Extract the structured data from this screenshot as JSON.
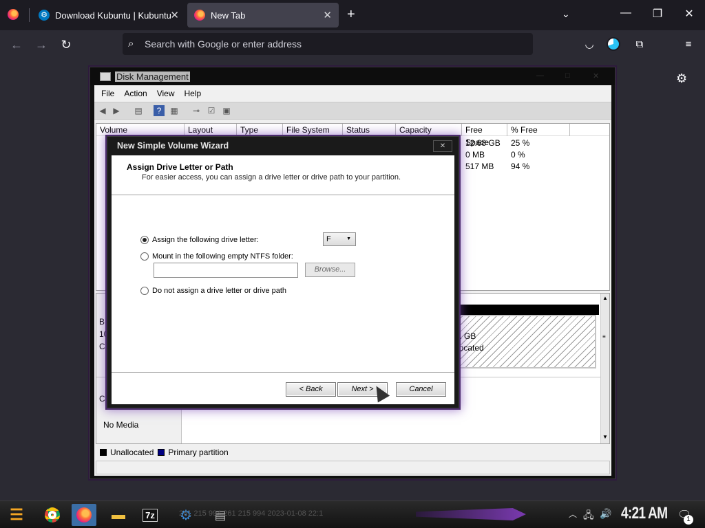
{
  "browser": {
    "tabs": [
      {
        "title": "Download Kubuntu | Kubuntu",
        "close": "✕"
      },
      {
        "title": "New Tab",
        "close": "✕"
      }
    ],
    "new_tab": "+",
    "tab_list": "⌄",
    "window_controls": {
      "minimize": "—",
      "maximize": "❐",
      "close": "✕"
    },
    "address_placeholder": "Search with Google or enter address"
  },
  "disk_mgmt": {
    "title": "Disk Management",
    "menu": [
      "File",
      "Action",
      "View",
      "Help"
    ],
    "columns": [
      "Volume",
      "Layout",
      "Type",
      "File System",
      "Status",
      "Capacity",
      "Free Space",
      "% Free"
    ],
    "rows": [
      {
        "free_space": "12.68 GB",
        "pct_free": "25 %"
      },
      {
        "free_space": "0 MB",
        "pct_free": "0 %"
      },
      {
        "free_space": "517 MB",
        "pct_free": "94 %"
      }
    ],
    "graph_left_fragments": [
      "B",
      "10",
      "C",
      "C"
    ],
    "unalloc_size": "1 GB",
    "unalloc_label": "located",
    "no_media": "No Media",
    "legend": {
      "unallocated": "Unallocated",
      "primary": "Primary partition"
    },
    "colors": {
      "unallocated": "#000000",
      "primary": "#000080"
    }
  },
  "wizard": {
    "title": "New Simple Volume Wizard",
    "close": "✕",
    "heading": "Assign Drive Letter or Path",
    "subheading": "For easier access, you can assign a drive letter or drive path to your partition.",
    "options": {
      "assign_letter": "Assign the following drive letter:",
      "mount_folder": "Mount in the following empty NTFS folder:",
      "no_assign": "Do not assign a drive letter or drive path"
    },
    "drive_letter": "F",
    "browse": "Browse...",
    "back": "< Back",
    "next": "Next >",
    "cancel": "Cancel"
  },
  "taskbar": {
    "ghost_text": "261 215 994      261 215 994      2023-01-08 22:1",
    "clock": "4:21 AM",
    "notif_count": "1"
  }
}
